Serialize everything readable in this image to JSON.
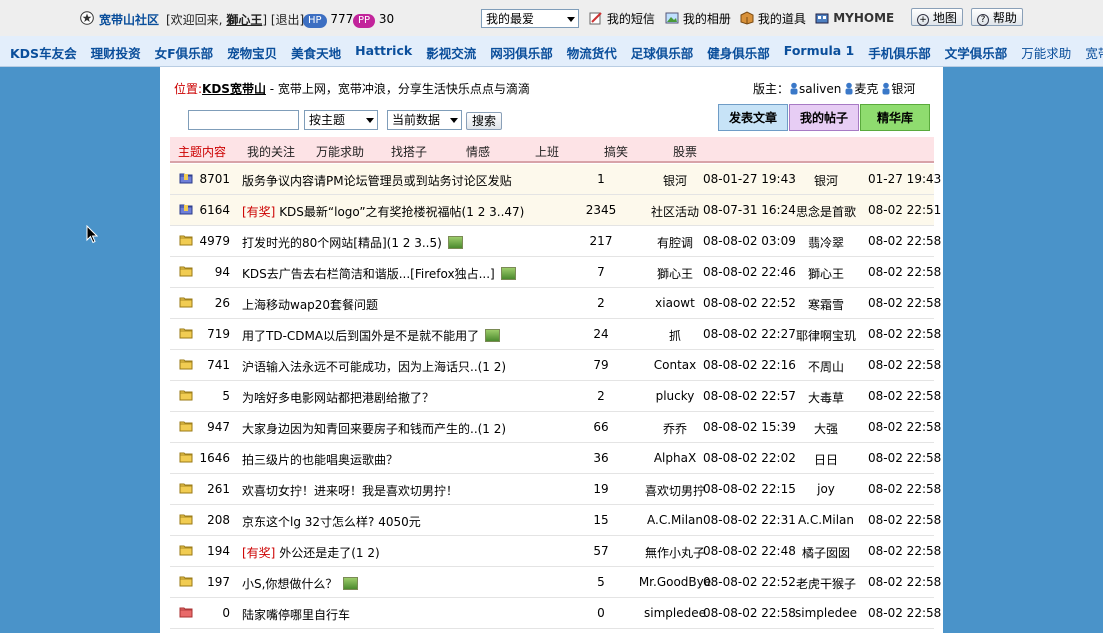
{
  "top": {
    "site_name": "宽带山社区",
    "welcome": "[欢迎回来,",
    "username": "獅心王",
    "bracket_close": "]",
    "logout": "[退出]",
    "hp_label": "HP",
    "hp_value": "777",
    "pp_label": "PP",
    "pp_value": "30",
    "favorites_select": "我的最爱",
    "sms": "我的短信",
    "album": "我的相册",
    "items": "我的道具",
    "myhome": "MYHOME",
    "map": "地图",
    "help": "帮助"
  },
  "nav": {
    "items": [
      "KDS车友会",
      "理财投资",
      "女F俱乐部",
      "宠物宝贝",
      "美食天地",
      "Hattrick",
      "影视交流",
      "网羽俱乐部",
      "物流货代",
      "足球俱乐部",
      "健身俱乐部",
      "Formula 1",
      "手机俱乐部",
      "文学俱乐部"
    ],
    "light_items": [
      "万能求助",
      "宽带山"
    ]
  },
  "location": {
    "label": "位置:",
    "board": "KDS宽带山",
    "desc": " - 宽带上网，宽带冲浪，分享生活快乐点点与滴滴",
    "moderators_label": "版主：",
    "moderators": [
      "saliven",
      "麦克",
      "银河"
    ]
  },
  "search": {
    "input_value": "",
    "by_select": "按主题",
    "scope_select": "当前数据",
    "button": "搜索"
  },
  "actions": {
    "post": "发表文章",
    "my_posts": "我的帖子",
    "digest": "精华库"
  },
  "tabs": [
    "主题内容",
    "我的关注",
    "万能求助",
    "找搭子",
    "情感",
    "上班",
    "搞笑",
    "股票"
  ],
  "rows": [
    {
      "icon": "pinned",
      "num": "8701",
      "tag": "",
      "title": "版务争议内容请PM论坛管理员或到站务讨论区发贴",
      "img": false,
      "replies": "1",
      "author": "银河",
      "time": "08-01-27 19:43",
      "last": "银河",
      "ltime": "01-27 19:43"
    },
    {
      "icon": "pinned",
      "num": "6164",
      "tag": "[有奖]",
      "title": " KDS最新“logo”之有奖抢楼祝福帖(1 2 3..47)",
      "img": false,
      "replies": "2345",
      "author": "社区活动",
      "time": "08-07-31 16:24",
      "last": "思念是首歌",
      "ltime": "08-02 22:51"
    },
    {
      "icon": "normal",
      "num": "4979",
      "tag": "",
      "title": "打发时光的80个网站[精品](1 2 3..5)",
      "img": true,
      "replies": "217",
      "author": "有腔调",
      "time": "08-08-02 03:09",
      "last": "翡冷翠",
      "ltime": "08-02 22:58"
    },
    {
      "icon": "normal",
      "num": "94",
      "tag": "",
      "title": "KDS去广告去右栏简洁和谐版...[Firefox独占...]",
      "img": true,
      "replies": "7",
      "author": "獅心王",
      "time": "08-08-02 22:46",
      "last": "獅心王",
      "ltime": "08-02 22:58"
    },
    {
      "icon": "normal",
      "num": "26",
      "tag": "",
      "title": "上海移动wap20套餐问题",
      "img": false,
      "replies": "2",
      "author": "xiaowt",
      "time": "08-08-02 22:52",
      "last": "寒霜雪",
      "ltime": "08-02 22:58"
    },
    {
      "icon": "normal",
      "num": "719",
      "tag": "",
      "title": "用了TD-CDMA以后到国外是不是就不能用了",
      "img": true,
      "replies": "24",
      "author": "抓",
      "time": "08-08-02 22:27",
      "last": "耶律啊宝玑",
      "ltime": "08-02 22:58"
    },
    {
      "icon": "normal",
      "num": "741",
      "tag": "",
      "title": "沪语输入法永远不可能成功，因为上海话只..(1 2)",
      "img": false,
      "replies": "79",
      "author": "Contax",
      "time": "08-08-02 22:16",
      "last": "不周山",
      "ltime": "08-02 22:58"
    },
    {
      "icon": "normal",
      "num": "5",
      "tag": "",
      "title": "为啥好多电影网站都把港剧给撤了？",
      "img": false,
      "replies": "2",
      "author": "plucky",
      "time": "08-08-02 22:57",
      "last": "大毒草",
      "ltime": "08-02 22:58"
    },
    {
      "icon": "normal",
      "num": "947",
      "tag": "",
      "title": "大家身边因为知青回来要房子和钱而产生的..(1 2)",
      "img": false,
      "replies": "66",
      "author": "乔乔",
      "time": "08-08-02 15:39",
      "last": "大强",
      "ltime": "08-02 22:58"
    },
    {
      "icon": "normal",
      "num": "1646",
      "tag": "",
      "title": "拍三级片的也能唱奥运歌曲？",
      "img": false,
      "replies": "36",
      "author": "AlphaX",
      "time": "08-08-02 22:02",
      "last": "日日",
      "ltime": "08-02 22:58"
    },
    {
      "icon": "normal",
      "num": "261",
      "tag": "",
      "title": "欢喜切女拧！进来呀！我是喜欢切男拧！",
      "img": false,
      "replies": "19",
      "author": "喜欢切男拧",
      "time": "08-08-02 22:15",
      "last": "joy",
      "ltime": "08-02 22:58"
    },
    {
      "icon": "normal",
      "num": "208",
      "tag": "",
      "title": "京东这个lg 32寸怎么样? 4050元",
      "img": false,
      "replies": "15",
      "author": "A.C.Milan",
      "time": "08-08-02 22:31",
      "last": "A.C.Milan",
      "ltime": "08-02 22:58"
    },
    {
      "icon": "normal",
      "num": "194",
      "tag": "[有奖]",
      "title": " 外公还是走了(1 2)",
      "img": false,
      "replies": "57",
      "author": "無作小丸子",
      "time": "08-08-02 22:48",
      "last": "橘子囡囡",
      "ltime": "08-02 22:58"
    },
    {
      "icon": "normal",
      "num": "197",
      "tag": "",
      "title": "小S,你想做什么？",
      "img": true,
      "replies": "5",
      "author": "Mr.GoodBye",
      "time": "08-08-02 22:52",
      "last": "老虎干猴子",
      "ltime": "08-02 22:58"
    },
    {
      "icon": "new",
      "num": "0",
      "tag": "",
      "title": "陆家嘴停哪里自行车",
      "img": false,
      "replies": "0",
      "author": "simpledee",
      "time": "08-08-02 22:58",
      "last": "simpledee",
      "ltime": "08-02 22:58"
    }
  ]
}
